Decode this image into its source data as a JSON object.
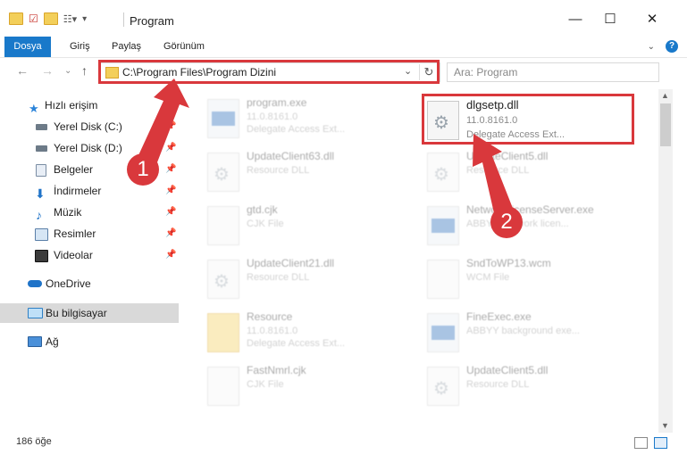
{
  "window": {
    "title": "Program"
  },
  "ribbon": {
    "tabs": [
      "Dosya",
      "Giriş",
      "Paylaş",
      "Görünüm"
    ]
  },
  "address": {
    "path": "C:\\Program Files\\Program Dizini"
  },
  "search": {
    "placeholder": "Ara: Program"
  },
  "sidebar": {
    "items": [
      {
        "label": "Hızlı erişim",
        "icon": "star-icon"
      },
      {
        "label": "Yerel Disk (C:)",
        "icon": "drive-icon"
      },
      {
        "label": "Yerel Disk (D:)",
        "icon": "drive-icon"
      },
      {
        "label": "Belgeler",
        "icon": "documents-icon"
      },
      {
        "label": "İndirmeler",
        "icon": "download-icon"
      },
      {
        "label": "Müzik",
        "icon": "music-icon"
      },
      {
        "label": "Resimler",
        "icon": "pictures-icon"
      },
      {
        "label": "Videolar",
        "icon": "video-icon"
      },
      {
        "label": "OneDrive",
        "icon": "cloud-icon"
      },
      {
        "label": "Bu bilgisayar",
        "icon": "computer-icon"
      },
      {
        "label": "Ağ",
        "icon": "network-icon"
      }
    ]
  },
  "files": [
    {
      "name": "program.exe",
      "l2": "11.0.8161.0",
      "l3": "Delegate Access Ext...",
      "icon": "exe"
    },
    {
      "name": "dlgsetp.dll",
      "l2": "11.0.8161.0",
      "l3": "Delegate Access Ext...",
      "icon": "gear"
    },
    {
      "name": "UpdateClient63.dll",
      "l2": "Resource DLL",
      "l3": "",
      "icon": "gear"
    },
    {
      "name": "UpdateClient5.dll",
      "l2": "Resource DLL",
      "l3": "",
      "icon": "gear"
    },
    {
      "name": "gtd.cjk",
      "l2": "CJK File",
      "l3": "",
      "icon": "blank"
    },
    {
      "name": "NetworkLicenseServer.exe",
      "l2": "ABBYY Network licen...",
      "l3": "",
      "icon": "app"
    },
    {
      "name": "UpdateClient21.dll",
      "l2": "Resource DLL",
      "l3": "",
      "icon": "gear"
    },
    {
      "name": "SndToWP13.wcm",
      "l2": "WCM File",
      "l3": "",
      "icon": "blank"
    },
    {
      "name": "Resource",
      "l2": "11.0.8161.0",
      "l3": "Delegate Access Ext...",
      "icon": "folder"
    },
    {
      "name": "FineExec.exe",
      "l2": "ABBYY background exe...",
      "l3": "",
      "icon": "app"
    },
    {
      "name": "FastNmrl.cjk",
      "l2": "CJK File",
      "l3": "",
      "icon": "blank"
    },
    {
      "name": "UpdateClient5.dll",
      "l2": "Resource DLL",
      "l3": "",
      "icon": "gear"
    }
  ],
  "status": {
    "count": "186 öğe"
  },
  "annotations": {
    "badge1": "1",
    "badge2": "2"
  },
  "colors": {
    "accent": "#1979ca",
    "highlight": "#d9383c"
  }
}
